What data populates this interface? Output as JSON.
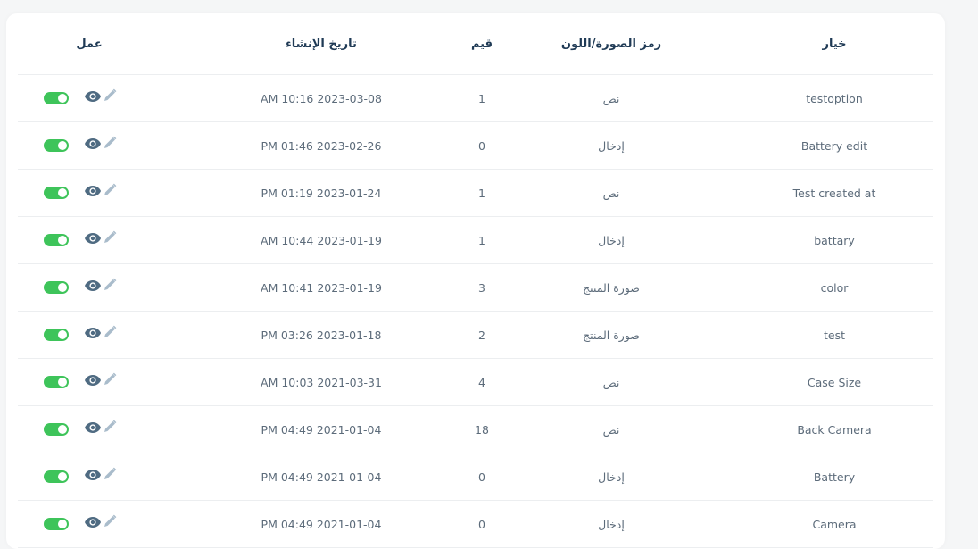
{
  "table": {
    "headers": {
      "option": "خيار",
      "type": "رمز الصورة/اللون",
      "values": "قيم",
      "created": "تاريخ الإنشاء",
      "action": "عمل"
    },
    "rows": [
      {
        "option": "testoption",
        "type": "نص",
        "values": "1",
        "created": "AM 10:16 2023-03-08",
        "active": true
      },
      {
        "option": "Battery edit",
        "type": "إدخال",
        "values": "0",
        "created": "PM 01:46 2023-02-26",
        "active": true
      },
      {
        "option": "Test created at",
        "type": "نص",
        "values": "1",
        "created": "PM 01:19 2023-01-24",
        "active": true
      },
      {
        "option": "battary",
        "type": "إدخال",
        "values": "1",
        "created": "AM 10:44 2023-01-19",
        "active": true
      },
      {
        "option": "color",
        "type": "صورة المنتج",
        "values": "3",
        "created": "AM 10:41 2023-01-19",
        "active": true
      },
      {
        "option": "test",
        "type": "صورة المنتج",
        "values": "2",
        "created": "PM 03:26 2023-01-18",
        "active": true
      },
      {
        "option": "Case Size",
        "type": "نص",
        "values": "4",
        "created": "AM 10:03 2021-03-31",
        "active": true
      },
      {
        "option": "Back Camera",
        "type": "نص",
        "values": "18",
        "created": "PM 04:49 2021-01-04",
        "active": true
      },
      {
        "option": "Battery",
        "type": "إدخال",
        "values": "0",
        "created": "PM 04:49 2021-01-04",
        "active": true
      },
      {
        "option": "Camera",
        "type": "إدخال",
        "values": "0",
        "created": "PM 04:49 2021-01-04",
        "active": true
      }
    ]
  },
  "icons": {
    "view": "eye-icon",
    "edit": "pencil-icon",
    "status": "toggle-switch"
  },
  "colors": {
    "toggle_on": "#3ec45a",
    "eye": "#4f6b82",
    "pencil": "#a9bccb",
    "header_text": "#1f3a55",
    "cell_text": "#5c6b7a"
  }
}
